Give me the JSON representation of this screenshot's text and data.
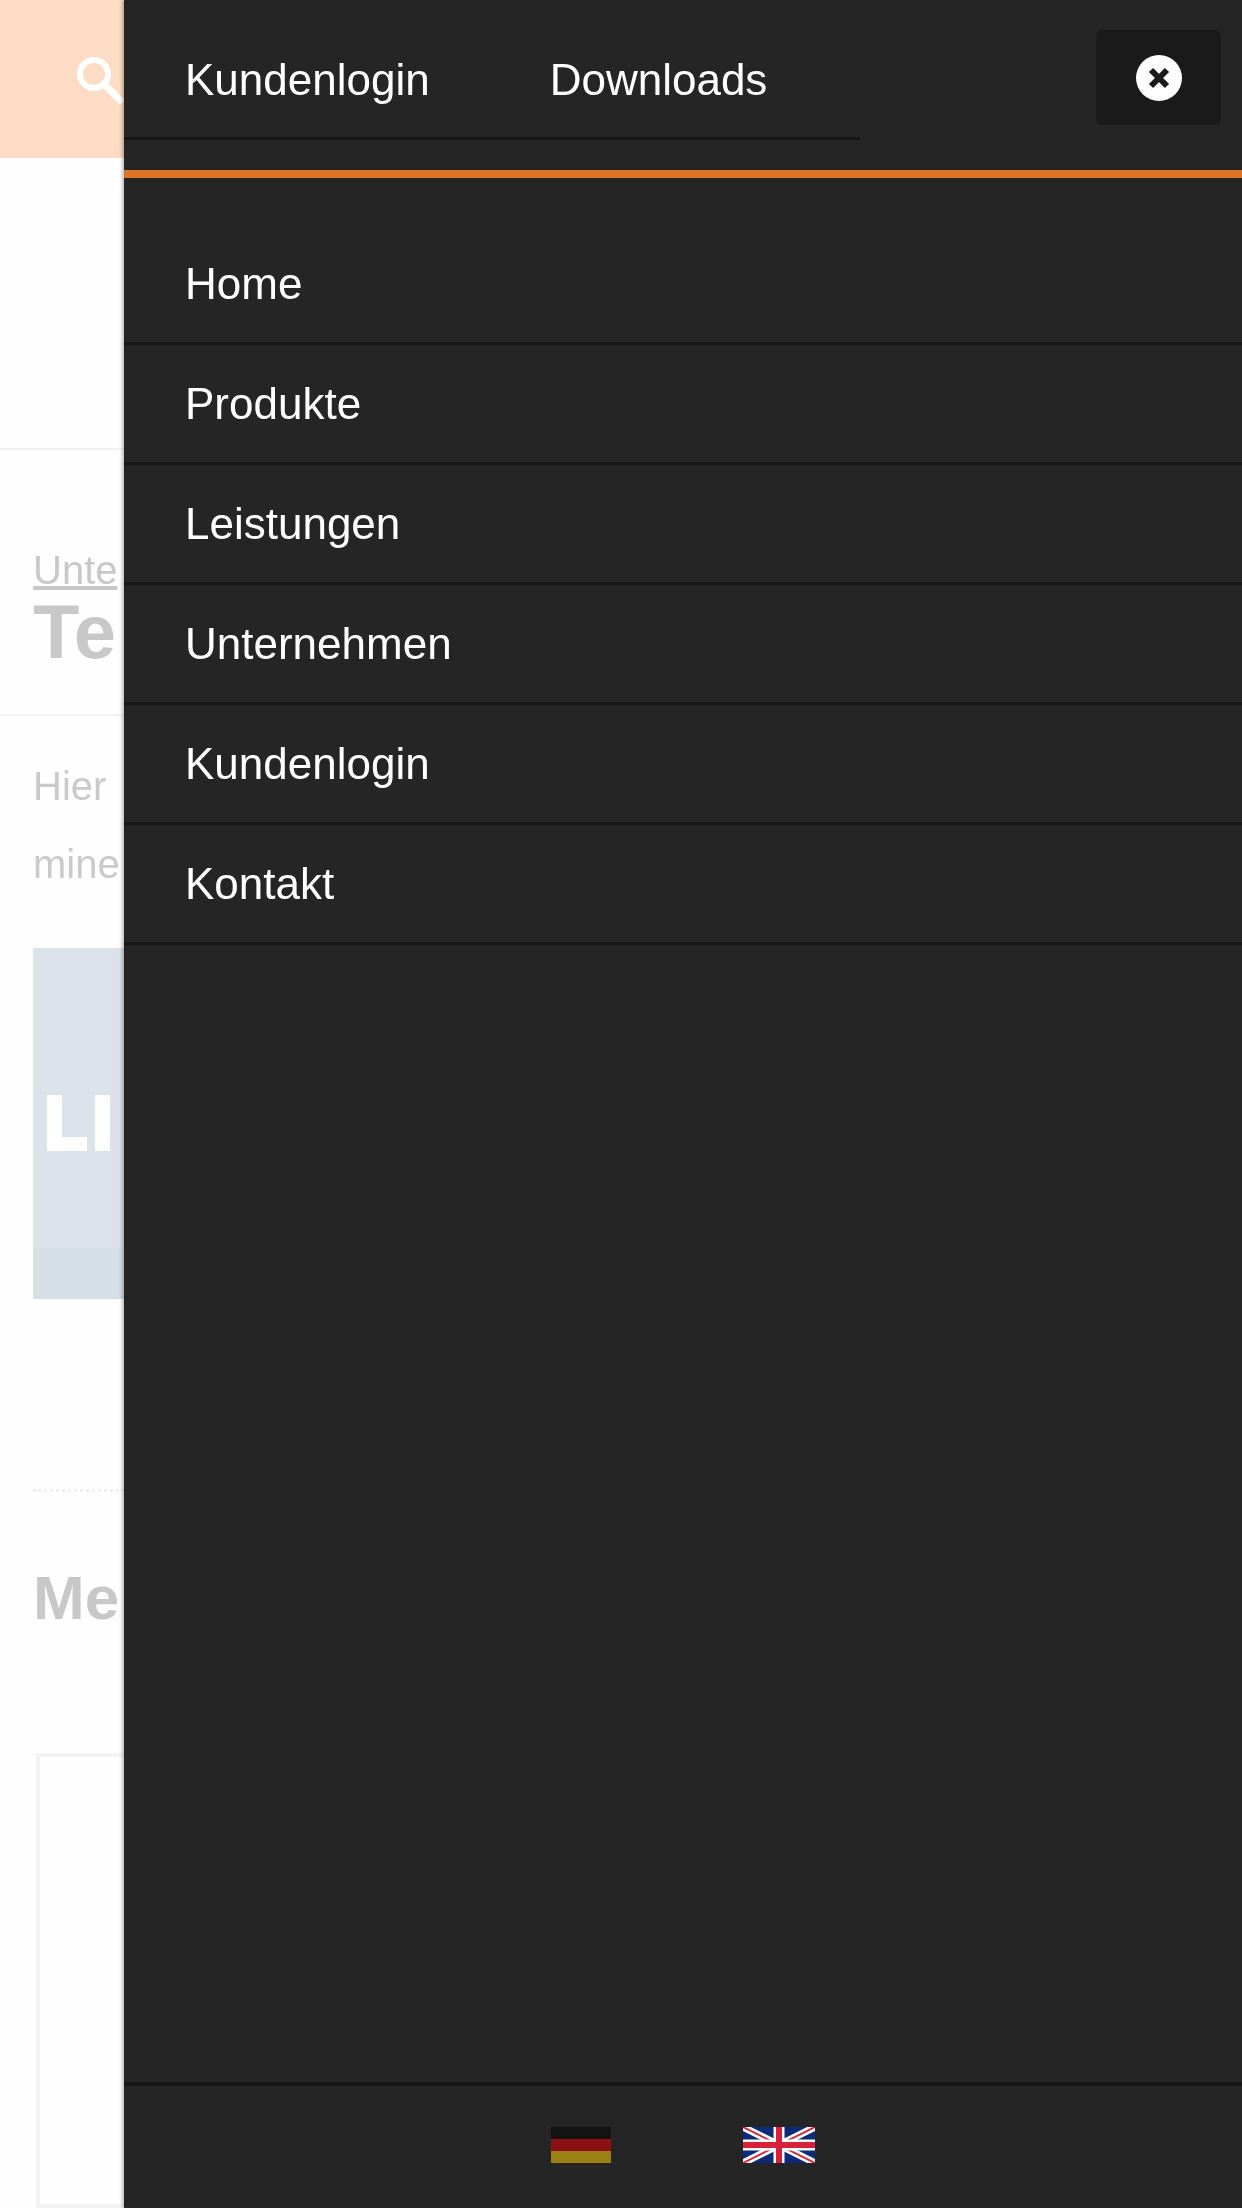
{
  "page": {
    "breadcrumb": "Unte",
    "title": "Te",
    "paragraph_lines": [
      "Hier",
      "mine"
    ],
    "section_title": "Me"
  },
  "drawer": {
    "top_links": [
      {
        "label": "Kundenlogin"
      },
      {
        "label": "Downloads"
      }
    ],
    "menu": [
      {
        "label": "Home"
      },
      {
        "label": "Produkte"
      },
      {
        "label": "Leistungen"
      },
      {
        "label": "Unternehmen"
      },
      {
        "label": "Kundenlogin"
      },
      {
        "label": "Kontakt"
      }
    ],
    "languages": [
      {
        "kind": "de"
      },
      {
        "kind": "gb"
      }
    ]
  }
}
